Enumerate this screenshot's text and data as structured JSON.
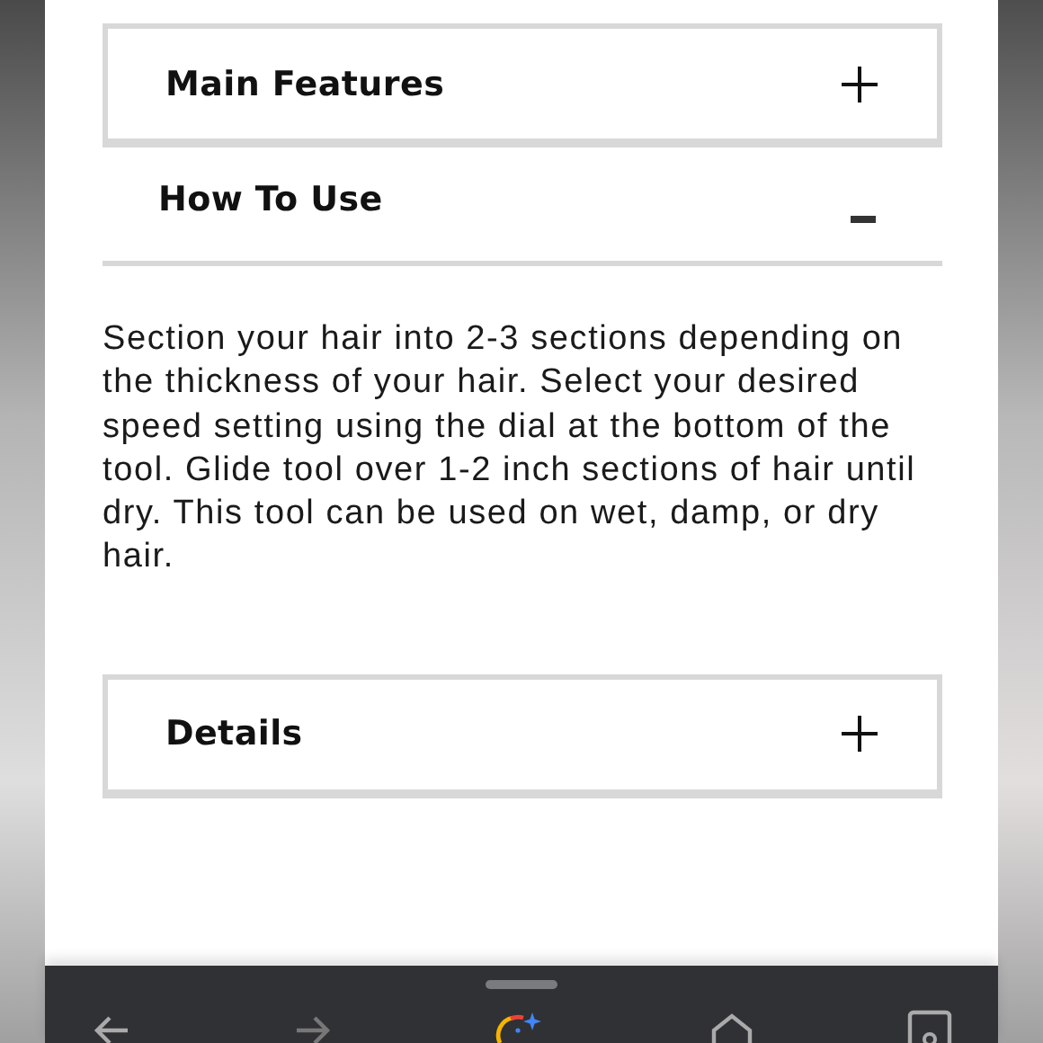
{
  "accordion": [
    {
      "title": "Main Features",
      "expanded": false
    },
    {
      "title": "How To Use",
      "expanded": true,
      "body": "Section your hair into 2-3 sections depending on the thickness of your hair. Select your desired speed setting using the dial at the bottom of the tool. Glide tool over 1-2 inch sections of hair until dry. This tool can be used on wet, damp, or dry hair."
    },
    {
      "title": "Details",
      "expanded": false
    }
  ]
}
